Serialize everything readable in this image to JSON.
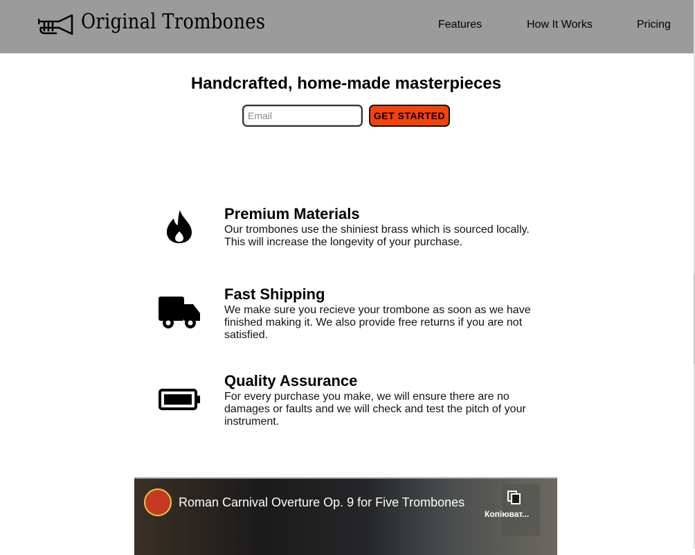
{
  "header": {
    "brand": "Original Trombones",
    "nav": {
      "features": "Features",
      "how_it_works": "How It Works",
      "pricing": "Pricing"
    }
  },
  "hero": {
    "title": "Handcrafted, home-made masterpieces",
    "email_placeholder": "Email",
    "cta_label": "GET STARTED"
  },
  "features": [
    {
      "icon": "fire-icon",
      "title": "Premium Materials",
      "description": "Our trombones use the shiniest brass which is sourced locally. This will increase the longevity of your purchase."
    },
    {
      "icon": "truck-icon",
      "title": "Fast Shipping",
      "description": "We make sure you recieve your trombone as soon as we have finished making it. We also provide free returns if you are not satisfied."
    },
    {
      "icon": "battery-full-icon",
      "title": "Quality Assurance",
      "description": "For every purchase you make, we will ensure there are no damages or faults and we will check and test the pitch of your instrument."
    }
  ],
  "video": {
    "title": "Roman Carnival Overture Op. 9 for Five Trombones",
    "copy_label": "Копіюват..."
  },
  "colors": {
    "header_bg": "#9b9b9b",
    "cta_bg": "#f3420c"
  }
}
